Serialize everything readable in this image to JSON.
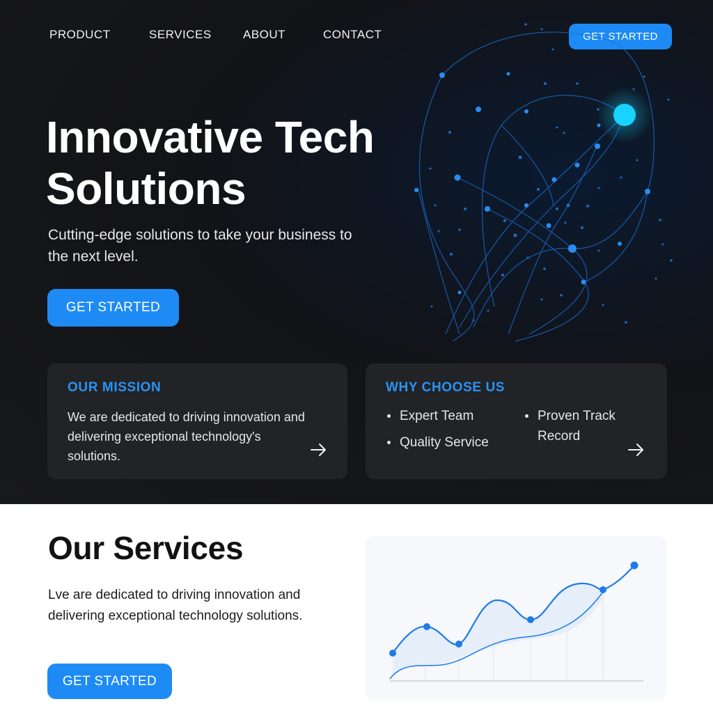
{
  "nav": {
    "links": [
      "PRODUCT",
      "SERVICES",
      "ABOUT",
      "CONTACT"
    ],
    "cta_label": "GET STARTED"
  },
  "hero": {
    "title_line1": "Innovative Tech",
    "title_line2": "Solutions",
    "subtitle": "Cutting-edge solutions to take your business to the next level.",
    "cta_label": "GET STARTED"
  },
  "mission": {
    "title": "OUR MISSION",
    "text": "We are dedicated to driving innovation and delivering exceptional technology's solutions."
  },
  "why": {
    "title": "WHY CHOOSE US",
    "bullets": [
      "Expert Team",
      "Quality Service",
      "Proven Track Record"
    ]
  },
  "services": {
    "title": "Our Services",
    "text": "Lve are dedicated to driving innovation and delivering exceptional technology solutions.",
    "cta_label": "GET STARTED"
  },
  "colors": {
    "accent": "#1e8bf5",
    "hero_bg": "#18191b",
    "card_bg": "#222326",
    "heading_accent": "#2b93f5"
  },
  "icons": {
    "arrow": "arrow-right-icon"
  }
}
